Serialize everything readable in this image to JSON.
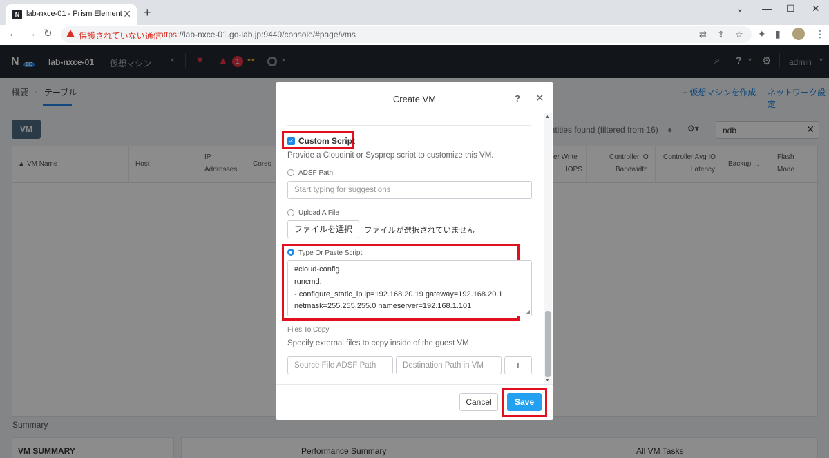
{
  "browser": {
    "tab_title": "lab-nxce-01 - Prism Element",
    "favicon_text": "N",
    "security_warning": "保護されていない通信",
    "url_scheme": "https",
    "url_rest": "://lab-nxce-01.go-lab.jp:9440/console/#page/vms"
  },
  "header": {
    "logo_text": "N",
    "logo_badge": "CE",
    "cluster_name": "lab-nxce-01",
    "menu_label": "仮想マシン",
    "alert_count": "1",
    "user": "admin"
  },
  "subnav": {
    "overview": "概要",
    "separator": "·",
    "table": "テーブル",
    "create_vm": "+ 仮想マシンを作成",
    "network_config": "ネットワーク設定"
  },
  "page": {
    "vm_tab": "VM",
    "entities_text": "entities found (filtered from 16)",
    "search_value": "ndb",
    "columns": {
      "vm_name": "VM Name",
      "host": "Host",
      "ip_1": "IP",
      "ip_2": "Addresses",
      "cores": "Cores",
      "ctrl_write_1": "oller Write",
      "ctrl_write_2": "IOPS",
      "ctrl_io_1": "Controller IO",
      "ctrl_io_2": "Bandwidth",
      "ctrl_avg_1": "Controller Avg IO",
      "ctrl_avg_2": "Latency",
      "backup": "Backup ...",
      "flash_1": "Flash",
      "flash_2": "Mode"
    },
    "summary_label": "Summary",
    "vm_summary": "VM SUMMARY",
    "performance_summary": "Performance Summary",
    "all_vm_tasks": "All VM Tasks"
  },
  "modal": {
    "title": "Create VM",
    "help": "?",
    "close": "✕",
    "custom_script_label": "Custom Script",
    "custom_script_checked": true,
    "description": "Provide a Cloudinit or Sysprep script to customize this VM.",
    "adsf_path_label": "ADSF Path",
    "adsf_placeholder": "Start typing for suggestions",
    "upload_label": "Upload A File",
    "file_button": "ファイルを選択",
    "file_status": "ファイルが選択されていません",
    "type_paste_label": "Type Or Paste Script",
    "selected_option": "Type Or Paste Script",
    "script_lines": [
      "#cloud-config",
      "runcmd:",
      "- configure_static_ip ip=192.168.20.19 gateway=192.168.20.1",
      "netmask=255.255.255.0 nameserver=192.168.1.101"
    ],
    "files_to_copy_label": "Files To Copy",
    "files_to_copy_desc": "Specify external files to copy inside of the guest VM.",
    "source_placeholder": "Source File ADSF Path",
    "dest_placeholder": "Destination Path in VM",
    "plus_label": "+",
    "cancel_label": "Cancel",
    "save_label": "Save"
  },
  "colors": {
    "accent": "#1e88e5",
    "save": "#23a0f0",
    "highlight": "#e2101e",
    "header_bg": "#22272e"
  }
}
